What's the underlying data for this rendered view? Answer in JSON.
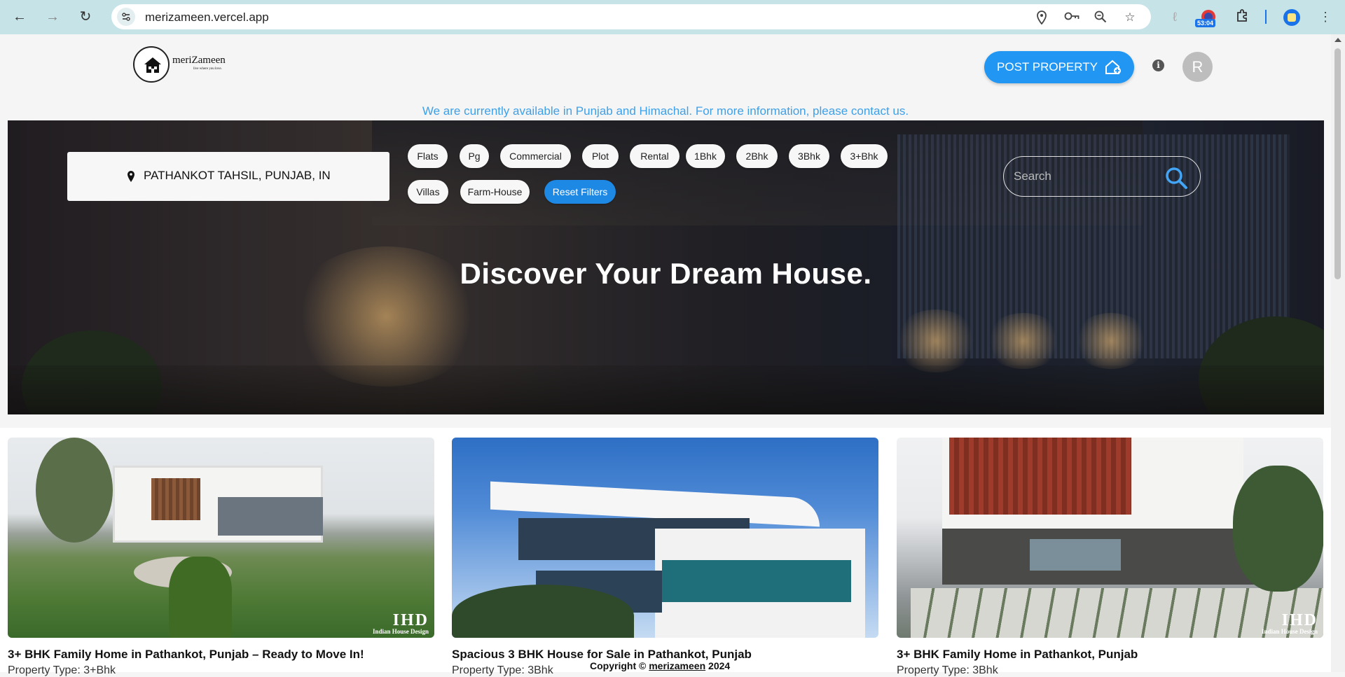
{
  "browser": {
    "url": "merizameen.vercel.app",
    "extension_badge": "53:04"
  },
  "header": {
    "logo_name": "meriZameen",
    "logo_tagline": "live where you love.",
    "post_property_label": "POST PROPERTY",
    "avatar_initial": "R"
  },
  "notice": "We are currently available in Punjab and Himachal. For more information, please contact us.",
  "hero": {
    "location": "PATHANKOT TAHSIL, PUNJAB, IN",
    "filters": [
      "Flats",
      "Pg",
      "Commercial",
      "Plot",
      "Rental",
      "1Bhk",
      "2Bhk",
      "3Bhk",
      "3+Bhk",
      "Villas",
      "Farm-House"
    ],
    "reset_label": "Reset Filters",
    "search_placeholder": "Search",
    "title": "Discover Your Dream House."
  },
  "cards": [
    {
      "title": "3+ BHK Family Home in Pathankot, Punjab – Ready to Move In!",
      "type_label": "Property Type:",
      "type_value": "3+Bhk",
      "watermark": "Indian House Design"
    },
    {
      "title": "Spacious 3 BHK House for Sale in Pathankot, Punjab",
      "type_label": "Property Type:",
      "type_value": "3Bhk"
    },
    {
      "title": "3+ BHK Family Home in Pathankot, Punjab",
      "type_label": "Property Type:",
      "type_value": "3Bhk",
      "watermark": "Indian House Design"
    }
  ],
  "footer": {
    "copyright_prefix": "Copyright ©",
    "brand": "merizameen",
    "year": "2024"
  },
  "colors": {
    "accent": "#2196f3",
    "notice": "#3ea0e8",
    "browser_bar": "#c6e3e8"
  }
}
